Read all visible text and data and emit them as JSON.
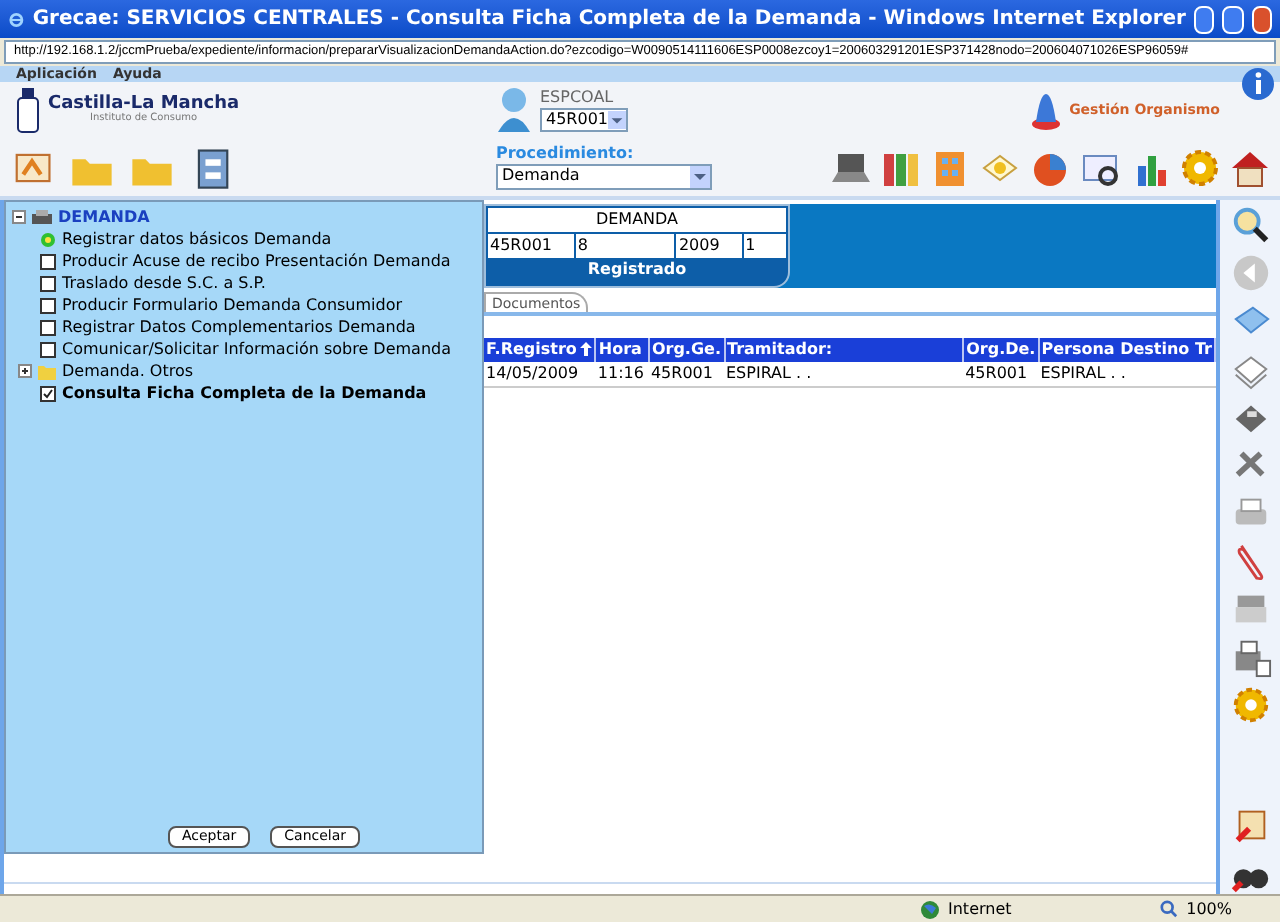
{
  "window": {
    "title": "Grecae: SERVICIOS CENTRALES - Consulta Ficha Completa de la Demanda - Windows Internet Explorer",
    "address": "http://192.168.1.2/jccmPrueba/expediente/informacion/prepararVisualizacionDemandaAction.do?ezcodigo=W0090514111606ESP0008ezcoy1=200603291201ESP371428nodo=200604071026ESP96059#"
  },
  "menu": [
    "Aplicación",
    "Ayuda"
  ],
  "header": {
    "logo_title": "Castilla-La Mancha",
    "logo_subtitle": "Instituto de Consumo",
    "user": "ESPCOAL",
    "office": "45R001",
    "org_link": "Gestión Organismo"
  },
  "procedure": {
    "label": "Procedimiento:",
    "value": "Demanda"
  },
  "tree": {
    "label": "DEMANDA",
    "expanded": true,
    "children": [
      {
        "kind": "task",
        "label": "Registrar datos básicos Demanda"
      },
      {
        "kind": "checkbox",
        "label": "Producir Acuse de recibo Presentación Demanda",
        "checked": false
      },
      {
        "kind": "checkbox",
        "label": "Traslado desde S.C. a S.P.",
        "checked": false
      },
      {
        "kind": "checkbox",
        "label": "Producir Formulario Demanda Consumidor",
        "checked": false
      },
      {
        "kind": "checkbox",
        "label": "Registrar Datos Complementarios Demanda",
        "checked": false
      },
      {
        "kind": "checkbox",
        "label": "Comunicar/Solicitar Información sobre Demanda",
        "checked": false
      },
      {
        "kind": "folder",
        "label": "Demanda. Otros",
        "expanded": false
      },
      {
        "kind": "checkbox",
        "label": "Consulta Ficha Completa de la Demanda",
        "checked": true
      }
    ]
  },
  "buttons": [
    "Aceptar",
    "Cancelar"
  ],
  "record": {
    "title": "DEMANDA",
    "fields": [
      "45R001",
      "8",
      "2009",
      "1"
    ],
    "status": "Registrado"
  },
  "tabs": [
    {
      "label": "Documentos",
      "selected": true
    }
  ],
  "table": {
    "columns": [
      {
        "label": "F.Registro",
        "sorted": true
      },
      {
        "label": "Hora",
        "sorted": false
      },
      {
        "label": "Org.Ge.",
        "sorted": false
      },
      {
        "label": "Tramitador:",
        "sorted": false
      },
      {
        "label": "Org.De.",
        "sorted": false
      },
      {
        "label": "Persona Destino Tr",
        "sorted": false
      }
    ],
    "rows": [
      [
        "14/05/2009",
        "11:16",
        "45R001",
        "ESPIRAL . .",
        "45R001",
        "ESPIRAL . ."
      ]
    ]
  },
  "status_bar": {
    "zone": "Internet",
    "zoom": "100%"
  }
}
